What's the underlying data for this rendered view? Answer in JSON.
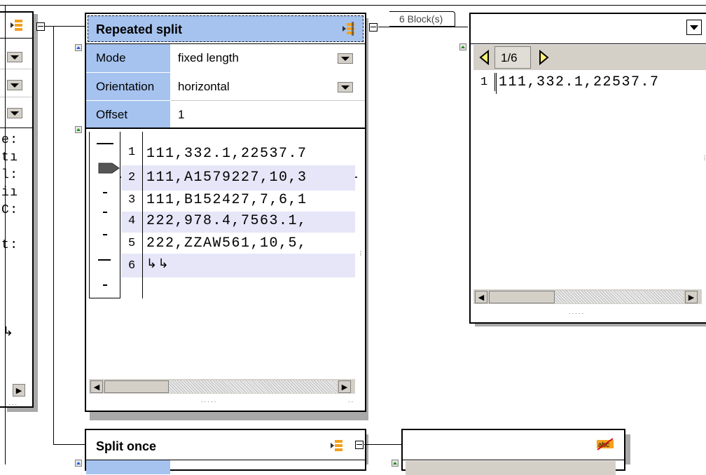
{
  "repeated_split": {
    "title": "Repeated split",
    "props": [
      {
        "label": "Mode",
        "value": "fixed length",
        "has_dropdown": true
      },
      {
        "label": "Orientation",
        "value": "horizontal",
        "has_dropdown": true
      },
      {
        "label": "Offset",
        "value": "1",
        "has_dropdown": false
      }
    ],
    "lines": [
      {
        "num": "1",
        "text": "111,332.1,22537.7"
      },
      {
        "num": "2",
        "text": "111,A1579227,10,3"
      },
      {
        "num": "3",
        "text": "111,B152427,7,6,1"
      },
      {
        "num": "4",
        "text": "222,978.4,7563.1,"
      },
      {
        "num": "5",
        "text": "222,ZZAW561,10,5,"
      },
      {
        "num": "6",
        "text": ""
      }
    ]
  },
  "connector_label": "6 Block(s)",
  "block_view": {
    "nav_page": "1/6",
    "line_num": "1",
    "line_text": "111,332.1,22537.7"
  },
  "left_panel": {
    "chars": [
      "e:",
      "tı",
      "l:",
      "iı",
      "C:",
      "",
      "t:"
    ]
  },
  "split_once": {
    "title": "Split once"
  },
  "colors": {
    "selected": "#a6c3ef",
    "alt_row": "#e6e6f8",
    "icon_orange": "#f4a11d"
  }
}
